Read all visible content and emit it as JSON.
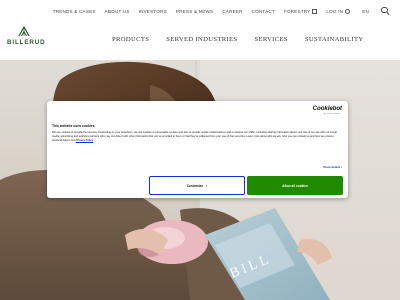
{
  "utility_nav": {
    "items": [
      "TRENDS & CASES",
      "ABOUT US",
      "INVESTORS",
      "PRESS & NEWS",
      "CAREER",
      "CONTACT",
      "FORESTRY"
    ],
    "login": "LOG IN",
    "language": "EN"
  },
  "brand": {
    "name": "BILLERUD",
    "color": "#2a5a2a"
  },
  "main_nav": {
    "items": [
      "PRODUCTS",
      "SERVED INDUSTRIES",
      "SERVICES",
      "SUSTAINABILITY"
    ]
  },
  "hero": {
    "product_text": "BILL"
  },
  "cookie_dialog": {
    "title": "This website uses cookies",
    "body": "We use cookies to provide the services. Depending on your selections, we use cookies to personalise content and ads, to provide social media features and to analyse our traffic. Including sharing information about your use of our site with our social media, advertising and analytics partners who may combine it with other information that you've provided to them or that they've collected from your use of their services. Learn more about who we are, how you can contact us and how we process personal data in our",
    "privacy_link": "Privacy Policy",
    "vendor": "Cookiebot",
    "vendor_sub": "by Usercentrics",
    "show_details": "Show details",
    "customize_label": "Customize",
    "allow_all_label": "Allow all cookies",
    "accent_color": "#1032cf",
    "allow_color": "#208a00"
  }
}
